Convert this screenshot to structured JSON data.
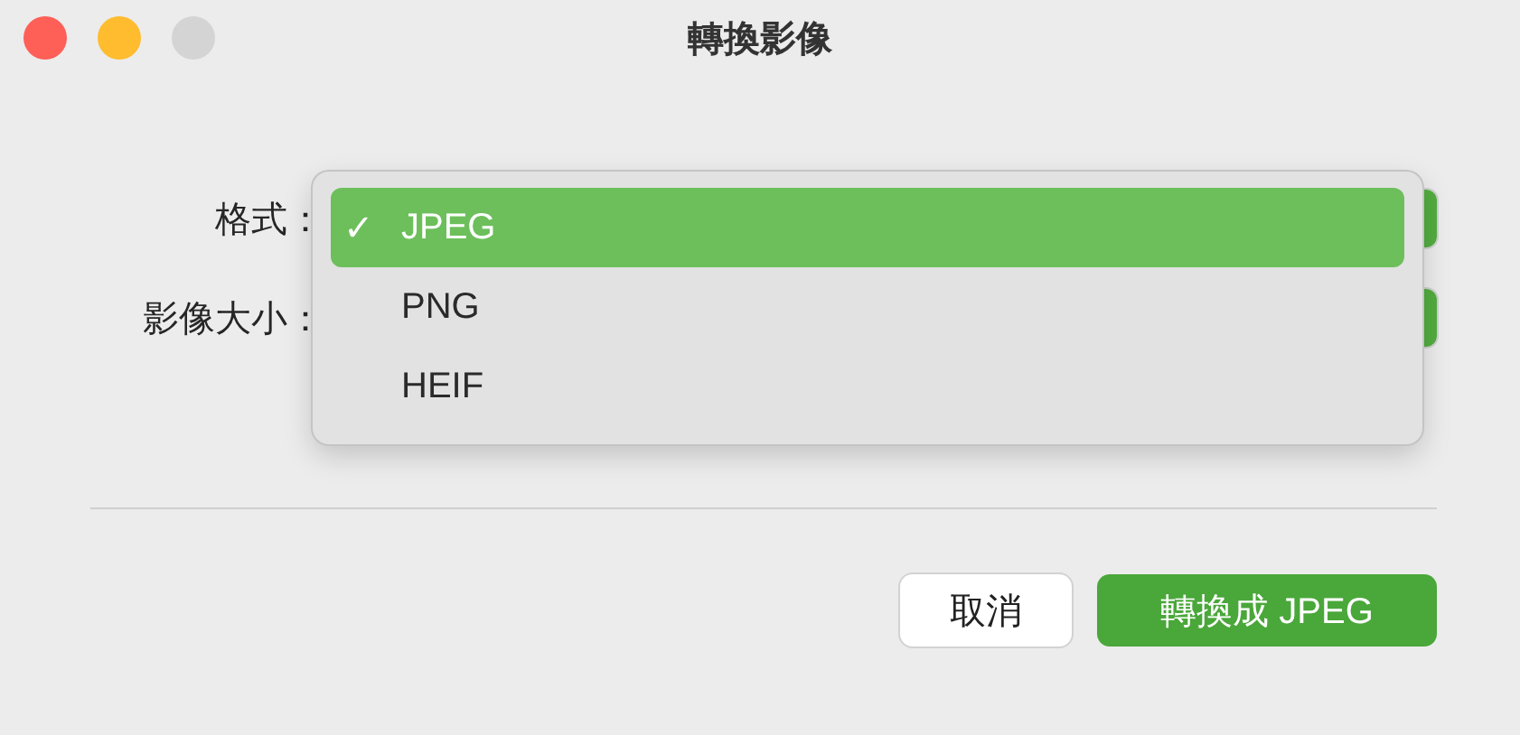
{
  "window": {
    "title": "轉換影像"
  },
  "fields": [
    {
      "label": "格式："
    },
    {
      "label": "影像大小："
    }
  ],
  "menu": {
    "mark": "✓",
    "items": [
      {
        "label": "JPEG",
        "selected": true
      },
      {
        "label": "PNG",
        "selected": false
      },
      {
        "label": "HEIF",
        "selected": false
      }
    ]
  },
  "buttons": [
    {
      "label": "取消",
      "kind": "cancel"
    },
    {
      "label": "轉換成 JPEG",
      "kind": "default"
    }
  ]
}
